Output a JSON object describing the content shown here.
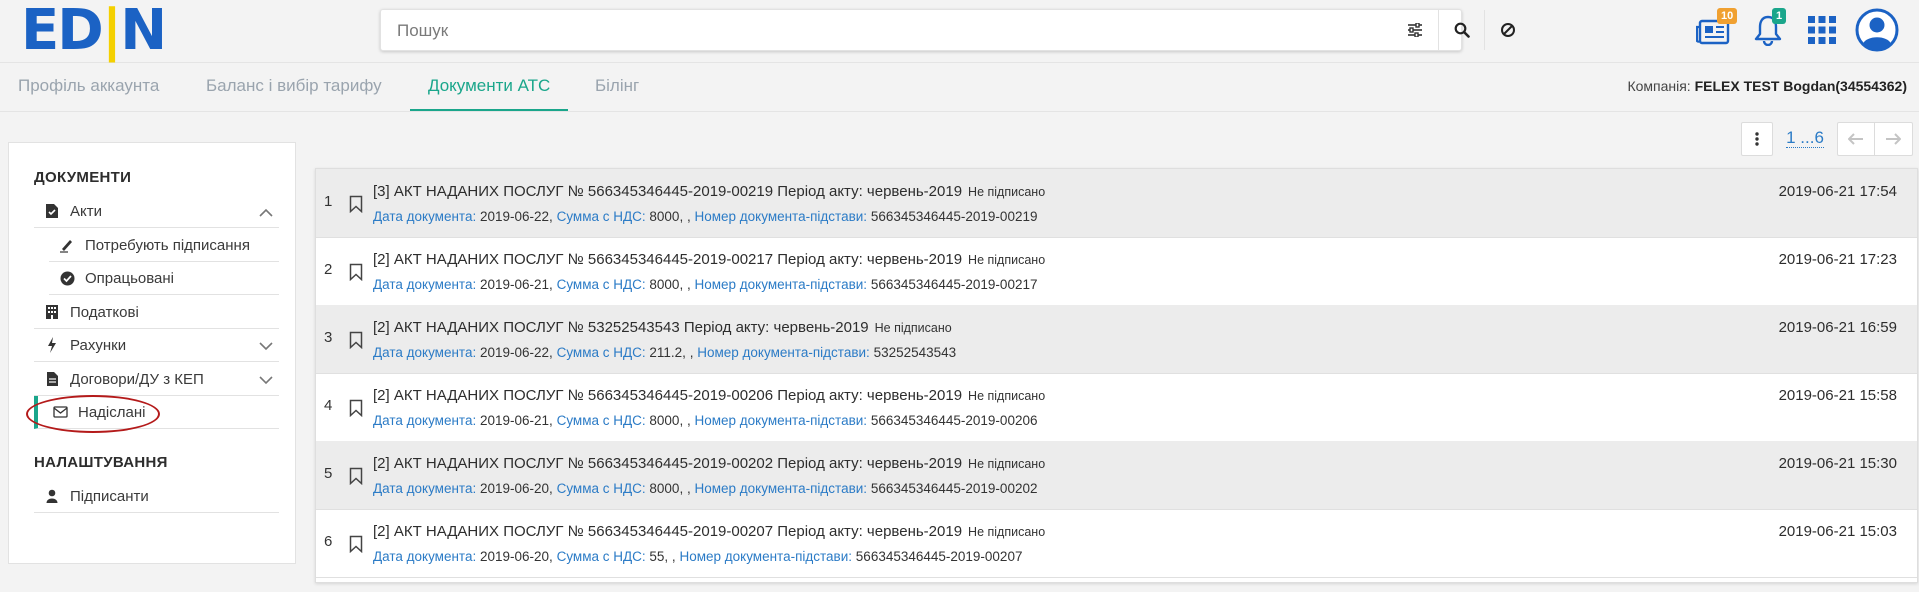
{
  "app": {
    "logo_text_b": "ED",
    "logo_text_y": "N",
    "search_placeholder": "Пошук",
    "news_badge": "10",
    "notif_badge": "1"
  },
  "tabs": [
    {
      "label": "Профіль аккаунта"
    },
    {
      "label": "Баланс і вибір тарифу"
    },
    {
      "label": "Документи АТС"
    },
    {
      "label": "Білінг"
    }
  ],
  "company": {
    "label": "Компанія:",
    "name": "FELEX TEST Bogdan(34554362)"
  },
  "sidebar": {
    "documents_head": "ДОКУМЕНТИ",
    "settings_head": "НАЛАШТУВАННЯ",
    "items": [
      {
        "label": "Акти"
      },
      {
        "label": "Потребують підписання"
      },
      {
        "label": "Опрацьовані"
      },
      {
        "label": "Податкові"
      },
      {
        "label": "Рахунки"
      },
      {
        "label": "Договори/ДУ з КЕП"
      },
      {
        "label": "Надіслані"
      },
      {
        "label": "Підписанти"
      }
    ]
  },
  "pager": {
    "pages": "1 ...6"
  },
  "labels": {
    "doc_date": "Дата документа:",
    "sum": "Сумма с НДС:",
    "basis": "Номер документа-підстави:"
  },
  "documents": [
    {
      "num": "1",
      "title": "[3] АКТ НАДАНИХ ПОСЛУГ   № 566345346445-2019-00219   Період акту: червень-2019",
      "status": "Не підписано",
      "doc_date": "2019-06-22,",
      "sum": "8000, ,",
      "basis": "566345346445-2019-00219",
      "datetime": "2019-06-21 17:54"
    },
    {
      "num": "2",
      "title": "[2] АКТ НАДАНИХ ПОСЛУГ   № 566345346445-2019-00217   Період акту: червень-2019",
      "status": "Не підписано",
      "doc_date": "2019-06-21,",
      "sum": "8000, ,",
      "basis": "566345346445-2019-00217",
      "datetime": "2019-06-21 17:23"
    },
    {
      "num": "3",
      "title": "[2] АКТ НАДАНИХ ПОСЛУГ   № 53252543543   Період акту: червень-2019",
      "status": "Не підписано",
      "doc_date": "2019-06-22,",
      "sum": "211.2, ,",
      "basis": "53252543543",
      "datetime": "2019-06-21 16:59"
    },
    {
      "num": "4",
      "title": "[2] АКТ НАДАНИХ ПОСЛУГ   № 566345346445-2019-00206   Період акту: червень-2019",
      "status": "Не підписано",
      "doc_date": "2019-06-21,",
      "sum": "8000, ,",
      "basis": "566345346445-2019-00206",
      "datetime": "2019-06-21 15:58"
    },
    {
      "num": "5",
      "title": "[2] АКТ НАДАНИХ ПОСЛУГ   № 566345346445-2019-00202   Період акту: червень-2019",
      "status": "Не підписано",
      "doc_date": "2019-06-20,",
      "sum": "8000, ,",
      "basis": "566345346445-2019-00202",
      "datetime": "2019-06-21 15:30"
    },
    {
      "num": "6",
      "title": "[2] АКТ НАДАНИХ ПОСЛУГ   № 566345346445-2019-00207   Період акту: червень-2019",
      "status": "Не підписано",
      "doc_date": "2019-06-20,",
      "sum": "55, ,",
      "basis": "566345346445-2019-00207",
      "datetime": "2019-06-21 15:03"
    }
  ]
}
